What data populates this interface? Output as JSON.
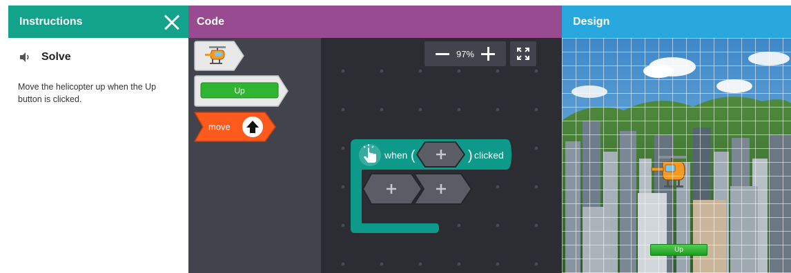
{
  "instructions": {
    "header_title": "Instructions",
    "section_title": "Solve",
    "text": "Move the helicopter up when the Up button is clicked."
  },
  "code": {
    "header_title": "Code",
    "zoom_level": "97%",
    "toolbox": {
      "button_block_label": "Up",
      "move_block_label": "move"
    },
    "event_block": {
      "when_label": "when",
      "open_paren": "(",
      "close_paren": ")",
      "clicked_label": "clicked"
    }
  },
  "design": {
    "header_title": "Design",
    "up_button_label": "Up"
  },
  "colors": {
    "instructions_header": "#13a28a",
    "code_header": "#984b91",
    "design_header": "#29a8de",
    "event_block": "#0d9a8a",
    "move_block": "#fe5a1d",
    "button_green": "#2fb531"
  },
  "icons": [
    "close-icon",
    "speaker-icon",
    "helicopter-icon",
    "up-arrow-icon",
    "fullscreen-icon",
    "tap-hand-icon",
    "plus-icon"
  ]
}
